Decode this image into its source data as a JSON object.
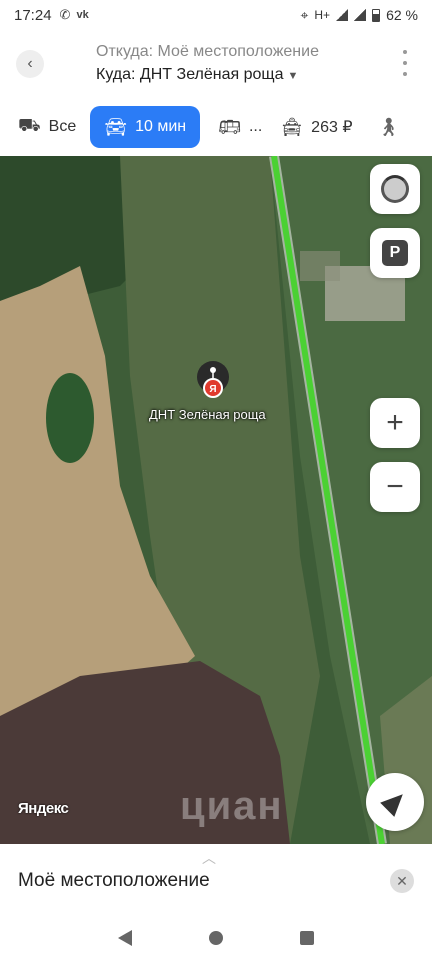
{
  "status_bar": {
    "time": "17:24",
    "network": "H+",
    "battery": "62 %"
  },
  "route": {
    "from": "Откуда: Моё местоположение",
    "to": "Куда: ДНТ Зелёная роща"
  },
  "tabs": [
    {
      "label": "Все",
      "icon": "car-stack-icon",
      "active": false
    },
    {
      "label": "10 мин",
      "icon": "car-icon",
      "active": true
    },
    {
      "label": "...",
      "icon": "bus-icon",
      "active": false
    },
    {
      "label": "263 ₽",
      "icon": "taxi-icon",
      "active": false
    }
  ],
  "map": {
    "poi_label": "ДНТ Зелёная роща",
    "provider": "Яндекс",
    "watermark": "циан",
    "route_color": "#4bd133",
    "accent_color": "#2b7cf6"
  },
  "sheet": {
    "title": "Моё местоположение"
  }
}
